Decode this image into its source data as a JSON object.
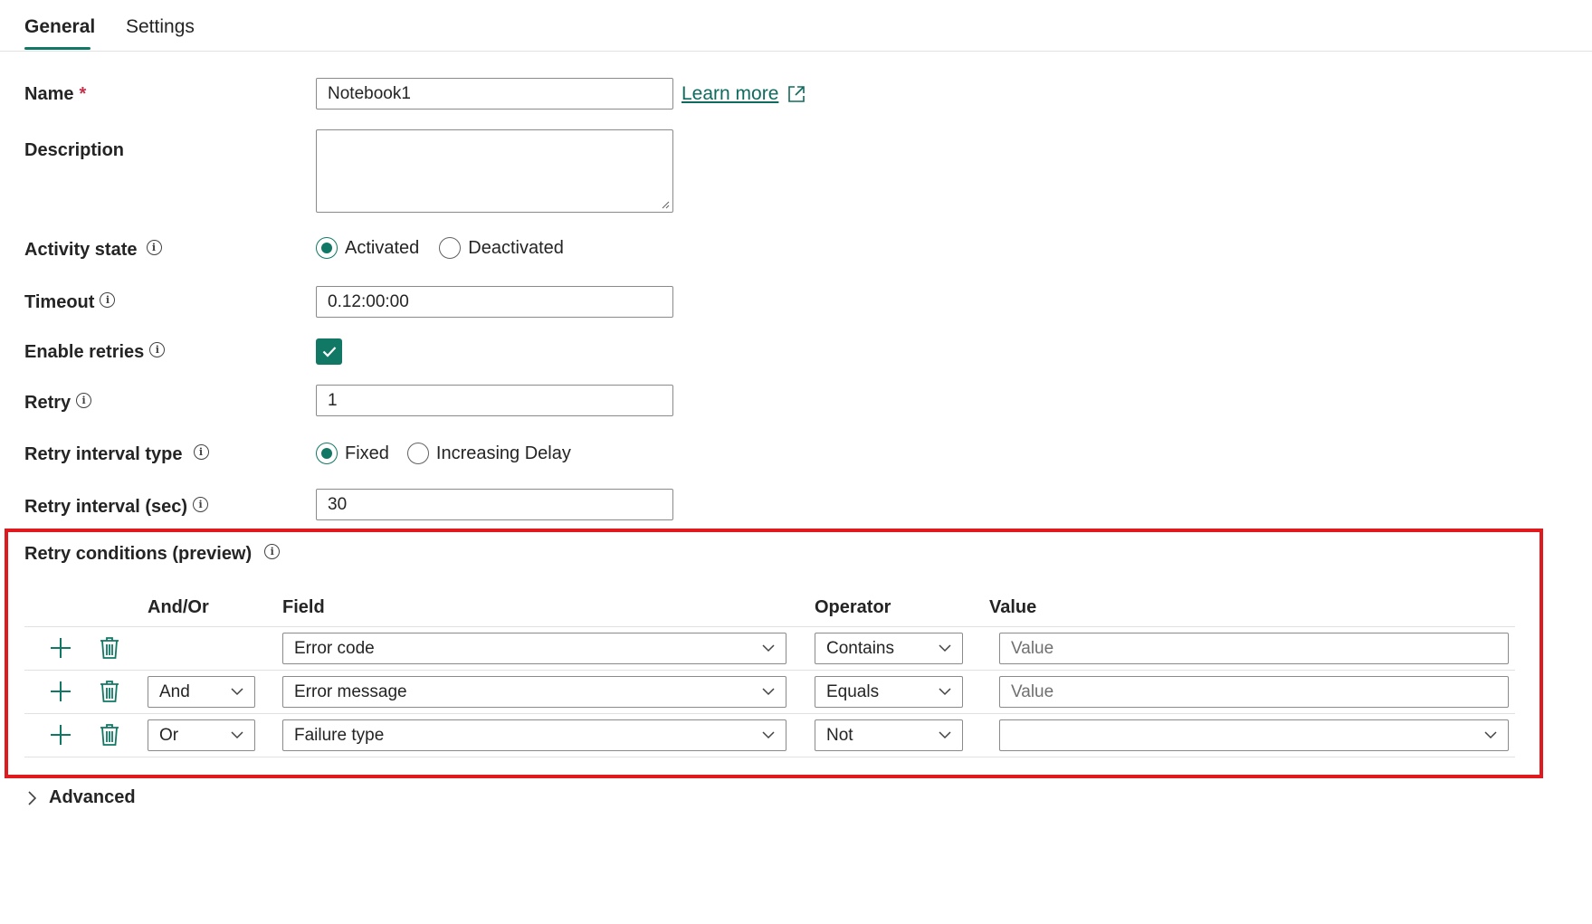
{
  "tabs": [
    {
      "label": "General",
      "active": true
    },
    {
      "label": "Settings",
      "active": false
    }
  ],
  "form": {
    "name_label": "Name",
    "name_required_mark": "*",
    "name_value": "Notebook1",
    "learn_more": "Learn more",
    "description_label": "Description",
    "description_value": "",
    "activity_state_label": "Activity state",
    "activity_options": [
      "Activated",
      "Deactivated"
    ],
    "activity_selected": "Activated",
    "timeout_label": "Timeout",
    "timeout_value": "0.12:00:00",
    "enable_retries_label": "Enable retries",
    "enable_retries_checked": true,
    "retry_label": "Retry",
    "retry_value": "1",
    "retry_interval_type_label": "Retry interval type",
    "retry_interval_options": [
      "Fixed",
      "Increasing Delay"
    ],
    "retry_interval_selected": "Fixed",
    "retry_interval_sec_label": "Retry interval (sec)",
    "retry_interval_sec_value": "30"
  },
  "conditions": {
    "title": "Retry conditions (preview)",
    "headers": {
      "andor": "And/Or",
      "field": "Field",
      "operator": "Operator",
      "value": "Value"
    },
    "rows": [
      {
        "andor": "",
        "field": "Error code",
        "operator": "Contains",
        "value_placeholder": "Value",
        "value_type": "input"
      },
      {
        "andor": "And",
        "field": "Error message",
        "operator": "Equals",
        "value_placeholder": "Value",
        "value_type": "input"
      },
      {
        "andor": "Or",
        "field": "Failure type",
        "operator": "Not",
        "value_placeholder": "",
        "value_type": "select"
      }
    ]
  },
  "advanced_label": "Advanced",
  "colors": {
    "accent": "#117865",
    "highlight_box": "#e0191f"
  }
}
